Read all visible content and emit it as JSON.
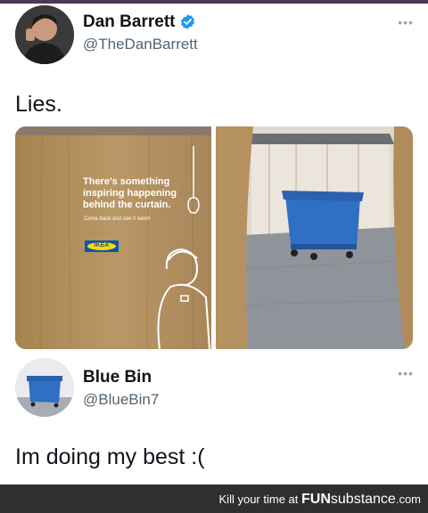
{
  "tweet1": {
    "author_name": "Dan Barrett",
    "author_handle": "@TheDanBarrett",
    "verified": true,
    "more_icon": "more-dots-icon",
    "text": "Lies.",
    "media": {
      "left_photo": {
        "headline_line1": "There's something",
        "headline_line2": "inspiring happening",
        "headline_line3": "behind the curtain.",
        "subline": "Come back and see it soon!",
        "logo_text": "IKEA"
      },
      "right_photo": {}
    }
  },
  "tweet2": {
    "author_name": "Blue Bin",
    "author_handle": "@BlueBin7",
    "more_icon": "more-dots-icon",
    "text": "Im doing my best :("
  },
  "footer": {
    "prefix": "Kill your time at ",
    "brand_bold": "FUN",
    "brand_rest": "substance",
    "suffix": ".com"
  },
  "colors": {
    "verified_blue": "#1d9bf0",
    "bin_blue": "#2f6fc4",
    "handle_gray": "#536471",
    "footer_bg": "#2f2f2f"
  }
}
